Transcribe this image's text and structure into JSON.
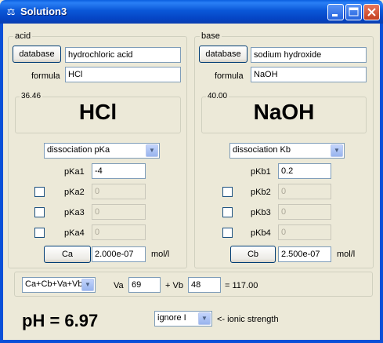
{
  "window": {
    "title": "Solution3"
  },
  "acid": {
    "group_label": "acid",
    "database_label": "database",
    "name": "hydrochloric acid",
    "formula_label": "formula",
    "formula": "HCl",
    "mw": "36.46",
    "display_formula": "HCl",
    "dissociation": "dissociation pKa",
    "rows": [
      {
        "label": "pKa1",
        "value": "-4",
        "enabled": true
      },
      {
        "label": "pKa2",
        "value": "0",
        "enabled": false
      },
      {
        "label": "pKa3",
        "value": "0",
        "enabled": false
      },
      {
        "label": "pKa4",
        "value": "0",
        "enabled": false
      }
    ],
    "conc_button": "Ca",
    "conc_value": "2.000e-07",
    "unit": "mol/l"
  },
  "base": {
    "group_label": "base",
    "database_label": "database",
    "name": "sodium hydroxide",
    "formula_label": "formula",
    "formula": "NaOH",
    "mw": "40.00",
    "display_formula": "NaOH",
    "dissociation": "dissociation Kb",
    "rows": [
      {
        "label": "pKb1",
        "value": "0.2",
        "enabled": true
      },
      {
        "label": "pKb2",
        "value": "0",
        "enabled": false
      },
      {
        "label": "pKb3",
        "value": "0",
        "enabled": false
      },
      {
        "label": "pKb4",
        "value": "0",
        "enabled": false
      }
    ],
    "conc_button": "Cb",
    "conc_value": "2.500e-07",
    "unit": "mol/l"
  },
  "volume": {
    "mode": "Ca+Cb+Va+Vb",
    "va_label": "Va",
    "va_value": "69",
    "vb_label": "+ Vb",
    "vb_value": "48",
    "total": "= 117.00"
  },
  "result": {
    "ph": "pH = 6.97",
    "ionic_mode": "ignore I",
    "ionic_label": "<- ionic strength"
  }
}
